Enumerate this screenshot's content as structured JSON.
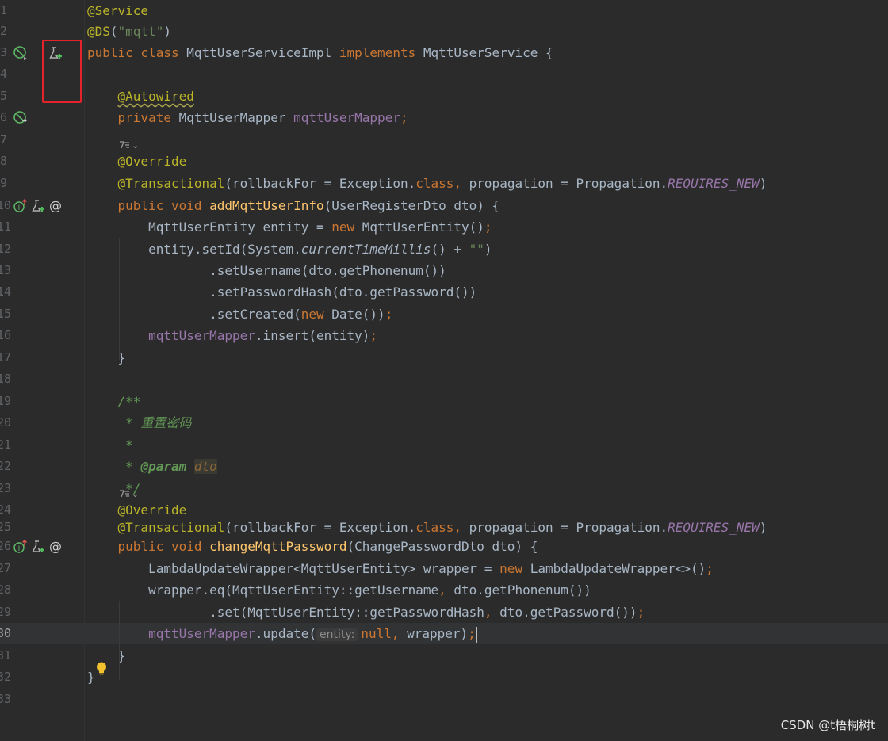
{
  "editor": {
    "lines": [
      {
        "n": "1",
        "tokens": [
          {
            "t": "@Service",
            "c": "ann"
          }
        ]
      },
      {
        "n": "2",
        "tokens": [
          {
            "t": "@DS",
            "c": "ann"
          },
          {
            "t": "(",
            "c": ""
          },
          {
            "t": "\"mqtt\"",
            "c": "str"
          },
          {
            "t": ")",
            "c": ""
          }
        ]
      },
      {
        "n": "3",
        "icons": [
          "no-bean-icon",
          "run-test-icon"
        ],
        "tokens": [
          {
            "t": "public class ",
            "c": "kw"
          },
          {
            "t": "MqttUserServiceImpl ",
            "c": ""
          },
          {
            "t": "implements ",
            "c": "kw"
          },
          {
            "t": "MqttUserService {",
            "c": ""
          }
        ]
      },
      {
        "n": "4",
        "tokens": []
      },
      {
        "n": "5",
        "tokens": [
          {
            "t": "    ",
            "c": ""
          },
          {
            "t": "@Autowired",
            "c": "warn"
          }
        ]
      },
      {
        "n": "6",
        "icons": [
          "bean-navigate-icon"
        ],
        "tokens": [
          {
            "t": "    ",
            "c": ""
          },
          {
            "t": "private ",
            "c": "kw"
          },
          {
            "t": "MqttUserMapper ",
            "c": ""
          },
          {
            "t": "mqttUserMapper",
            "c": "field"
          },
          {
            "t": ";",
            "c": "kw"
          }
        ]
      },
      {
        "n": "7",
        "tokens": []
      },
      {
        "n": "8",
        "inlay": true,
        "tokens": [
          {
            "t": "    ",
            "c": ""
          },
          {
            "t": "@Override",
            "c": "ann"
          }
        ]
      },
      {
        "n": "9",
        "tokens": [
          {
            "t": "    ",
            "c": ""
          },
          {
            "t": "@Transactional",
            "c": "ann"
          },
          {
            "t": "(rollbackFor = Exception.",
            "c": ""
          },
          {
            "t": "class, ",
            "c": "kw"
          },
          {
            "t": "propagation = Propagation.",
            "c": ""
          },
          {
            "t": "REQUIRES_NEW",
            "c": "static"
          },
          {
            "t": ")",
            "c": ""
          }
        ]
      },
      {
        "n": "10",
        "icons": [
          "implements-icon",
          "run-test-icon",
          "mapping-icon"
        ],
        "tokens": [
          {
            "t": "    ",
            "c": ""
          },
          {
            "t": "public void ",
            "c": "kw"
          },
          {
            "t": "addMqttUserInfo",
            "c": "fn"
          },
          {
            "t": "(UserRegisterDto dto) {",
            "c": ""
          }
        ]
      },
      {
        "n": "11",
        "tokens": [
          {
            "t": "        MqttUserEntity entity = ",
            "c": ""
          },
          {
            "t": "new ",
            "c": "kw"
          },
          {
            "t": "MqttUserEntity()",
            "c": ""
          },
          {
            "t": ";",
            "c": "kw"
          }
        ]
      },
      {
        "n": "12",
        "tokens": [
          {
            "t": "        entity.setId(System.",
            "c": ""
          },
          {
            "t": "currentTimeMillis",
            "c": "italic"
          },
          {
            "t": "() + ",
            "c": ""
          },
          {
            "t": "\"\"",
            "c": "str"
          },
          {
            "t": ")",
            "c": ""
          }
        ]
      },
      {
        "n": "13",
        "tokens": [
          {
            "t": "                .setUsername(dto.getPhonenum())",
            "c": ""
          }
        ]
      },
      {
        "n": "14",
        "tokens": [
          {
            "t": "                .setPasswordHash(dto.getPassword())",
            "c": ""
          }
        ]
      },
      {
        "n": "15",
        "tokens": [
          {
            "t": "                .setCreated(",
            "c": ""
          },
          {
            "t": "new ",
            "c": "kw"
          },
          {
            "t": "Date())",
            "c": ""
          },
          {
            "t": ";",
            "c": "kw"
          }
        ]
      },
      {
        "n": "16",
        "tokens": [
          {
            "t": "        ",
            "c": ""
          },
          {
            "t": "mqttUserMapper",
            "c": "field"
          },
          {
            "t": ".insert(entity)",
            "c": ""
          },
          {
            "t": ";",
            "c": "kw"
          }
        ]
      },
      {
        "n": "17",
        "tokens": [
          {
            "t": "    }",
            "c": ""
          }
        ]
      },
      {
        "n": "18",
        "tokens": []
      },
      {
        "n": "19",
        "tokens": [
          {
            "t": "    /**",
            "c": "comment"
          }
        ]
      },
      {
        "n": "20",
        "tokens": [
          {
            "t": "     * 重置密码",
            "c": "comment"
          }
        ]
      },
      {
        "n": "21",
        "tokens": [
          {
            "t": "     *",
            "c": "comment"
          }
        ]
      },
      {
        "n": "22",
        "tokens": [
          {
            "t": "     * ",
            "c": "comment"
          },
          {
            "t": "@param",
            "c": "tag"
          },
          {
            "t": " ",
            "c": "comment"
          },
          {
            "t": "dto",
            "c": "tagval"
          }
        ]
      },
      {
        "n": "23",
        "tokens": [
          {
            "t": "     */",
            "c": "comment"
          }
        ]
      },
      {
        "n": "24",
        "inlay": true,
        "tokens": [
          {
            "t": "    ",
            "c": ""
          },
          {
            "t": "@Override",
            "c": "ann"
          }
        ]
      },
      {
        "n": "25",
        "tokens": [
          {
            "t": "    ",
            "c": ""
          },
          {
            "t": "@Transactional",
            "c": "ann"
          },
          {
            "t": "(rollbackFor = Exception.",
            "c": ""
          },
          {
            "t": "class, ",
            "c": "kw"
          },
          {
            "t": "propagation = Propagation.",
            "c": ""
          },
          {
            "t": "REQUIRES_NEW",
            "c": "static"
          },
          {
            "t": ")",
            "c": ""
          }
        ]
      },
      {
        "n": "26",
        "icons": [
          "implements-icon",
          "run-test-icon",
          "mapping-icon"
        ],
        "tokens": [
          {
            "t": "    ",
            "c": ""
          },
          {
            "t": "public void ",
            "c": "kw"
          },
          {
            "t": "changeMqttPassword",
            "c": "fn"
          },
          {
            "t": "(ChangePasswordDto dto) {",
            "c": ""
          }
        ]
      },
      {
        "n": "27",
        "tokens": [
          {
            "t": "        LambdaUpdateWrapper<MqttUserEntity> wrapper = ",
            "c": ""
          },
          {
            "t": "new ",
            "c": "kw"
          },
          {
            "t": "LambdaUpdateWrapper<>()",
            "c": ""
          },
          {
            "t": ";",
            "c": "kw"
          }
        ]
      },
      {
        "n": "28",
        "tokens": [
          {
            "t": "        wrapper.eq(MqttUserEntity::getUsername",
            "c": ""
          },
          {
            "t": ", ",
            "c": "kw"
          },
          {
            "t": "dto.getPhonenum())",
            "c": ""
          }
        ]
      },
      {
        "n": "29",
        "tokens": [
          {
            "t": "                .set(MqttUserEntity::getPasswordHash",
            "c": ""
          },
          {
            "t": ", ",
            "c": "kw"
          },
          {
            "t": "dto.getPassword())",
            "c": ""
          },
          {
            "t": ";",
            "c": "kw"
          }
        ]
      },
      {
        "n": "30",
        "current": true,
        "tokens": [
          {
            "t": "        ",
            "c": ""
          },
          {
            "t": "mqttUserMapper",
            "c": "field"
          },
          {
            "t": ".update(",
            "c": ""
          },
          {
            "t": "entity:",
            "c": "hint"
          },
          {
            "t": "null, ",
            "c": "kw"
          },
          {
            "t": "wrapper)",
            "c": ""
          },
          {
            "t": ";",
            "c": "kw"
          },
          {
            "t": "",
            "c": "caret"
          }
        ]
      },
      {
        "n": "31",
        "tokens": [
          {
            "t": "    }",
            "c": ""
          }
        ]
      },
      {
        "n": "32",
        "tokens": [
          {
            "t": "}",
            "c": ""
          }
        ]
      },
      {
        "n": "33",
        "tokens": []
      }
    ]
  },
  "watermark": "CSDN @t梧桐树t",
  "colors": {
    "keyword": "#cc7832",
    "annotation": "#bbb529",
    "string": "#6a8759",
    "method": "#ffc66d",
    "field": "#9876aa",
    "comment": "#629755",
    "highlight_box": "#e5232b"
  }
}
